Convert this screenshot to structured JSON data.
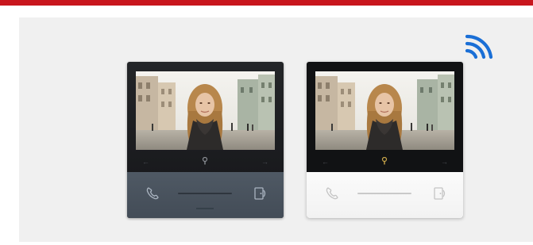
{
  "page": {
    "accent_color": "#c8161d",
    "panel_color": "#f0f0f0"
  },
  "wifi": {
    "icon": "wifi-icon",
    "color": "#1a6fd6"
  },
  "devices": [
    {
      "variant": "dark",
      "body_color": "#1b1c1f",
      "lower_panel_color": "#4a535e",
      "icons": [
        "video-preview",
        "left-arrow-icon",
        "key-icon",
        "right-arrow-icon",
        "handset-icon",
        "door-open-icon"
      ]
    },
    {
      "variant": "white",
      "body_color": "#111214",
      "lower_panel_color": "#f7f7f7",
      "icons": [
        "video-preview",
        "left-arrow-icon",
        "key-icon",
        "right-arrow-icon",
        "handset-icon",
        "door-open-icon"
      ]
    }
  ]
}
